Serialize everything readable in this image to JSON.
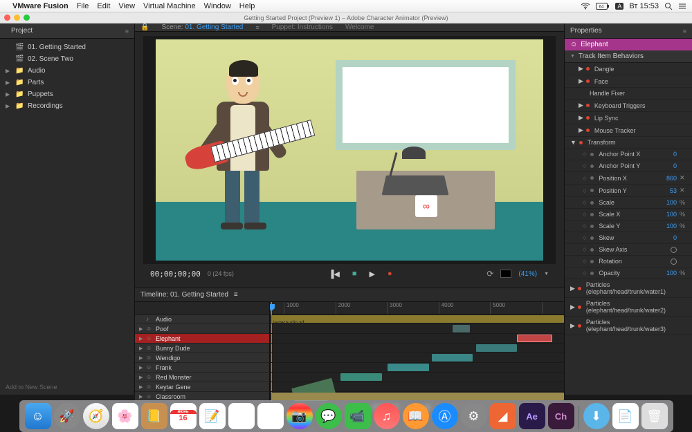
{
  "menubar": {
    "app": "VMware Fusion",
    "items": [
      "File",
      "Edit",
      "View",
      "Virtual Machine",
      "Window",
      "Help"
    ],
    "clock": "Вт 15:53",
    "input_badge": "A"
  },
  "window_title": "Getting Started Project (Preview 1) – Adobe Character Animator (Preview)",
  "project": {
    "title": "Project",
    "items": [
      {
        "icon": "scene",
        "label": "01. Getting Started",
        "expand": false
      },
      {
        "icon": "scene",
        "label": "02. Scene Two",
        "expand": false
      },
      {
        "icon": "folder",
        "label": "Audio",
        "expand": true
      },
      {
        "icon": "folder",
        "label": "Parts",
        "expand": true
      },
      {
        "icon": "folder",
        "label": "Puppets",
        "expand": true
      },
      {
        "icon": "folder",
        "label": "Recordings",
        "expand": true
      }
    ],
    "footer": "Add to New Scene"
  },
  "center": {
    "scene_label": "Scene:",
    "scene_name": "01. Getting Started",
    "puppet_label": "Puppet:",
    "puppet_name": "Instructions",
    "welcome": "Welcome"
  },
  "playback": {
    "timecode": "00;00;00;00",
    "fps": "0 (24 fps)",
    "zoom": "(41%)"
  },
  "timeline": {
    "title": "Timeline: 01. Getting Started",
    "ruler": [
      "1000",
      "2000",
      "3000",
      "4000",
      "5000"
    ],
    "audio_clip": "lasterAudio.aif",
    "tracks": [
      {
        "name": "Audio",
        "icon": "aud",
        "sel": false
      },
      {
        "name": "Poof",
        "icon": "pup",
        "sel": false
      },
      {
        "name": "Elephant",
        "icon": "pup",
        "sel": true
      },
      {
        "name": "Bunny Dude",
        "icon": "pup",
        "sel": false
      },
      {
        "name": "Wendigo",
        "icon": "pup",
        "sel": false
      },
      {
        "name": "Frank",
        "icon": "pup",
        "sel": false
      },
      {
        "name": "Red Monster",
        "icon": "pup",
        "sel": false
      },
      {
        "name": "Keytar Gene",
        "icon": "pup",
        "sel": false
      },
      {
        "name": "Classroom",
        "icon": "pup",
        "sel": false
      }
    ]
  },
  "properties": {
    "title": "Properties",
    "selected": "Elephant",
    "behaviors_title": "Track Item Behaviors",
    "behaviors": [
      "Dangle",
      "Face",
      "Handle Fixer",
      "Keyboard Triggers",
      "Lip Sync",
      "Mouse Tracker"
    ],
    "transform": {
      "title": "Transform",
      "rows": [
        {
          "name": "Anchor Point X",
          "val": "0",
          "unit": ""
        },
        {
          "name": "Anchor Point Y",
          "val": "0",
          "unit": ""
        },
        {
          "name": "Position X",
          "val": "860",
          "unit": "",
          "x": true
        },
        {
          "name": "Position Y",
          "val": "53",
          "unit": "",
          "x": true
        },
        {
          "name": "Scale",
          "val": "100",
          "unit": "%"
        },
        {
          "name": "Scale X",
          "val": "100",
          "unit": "%"
        },
        {
          "name": "Scale Y",
          "val": "100",
          "unit": "%"
        },
        {
          "name": "Skew",
          "val": "0",
          "unit": ""
        },
        {
          "name": "Skew Axis",
          "val": "",
          "unit": "",
          "clock": true
        },
        {
          "name": "Rotation",
          "val": "",
          "unit": "",
          "clock": true
        },
        {
          "name": "Opacity",
          "val": "100",
          "unit": "%"
        }
      ]
    },
    "particles": [
      "Particles (elephant/head/trunk/water1)",
      "Particles (elephant/head/trunk/water2)",
      "Particles (elephant/head/trunk/water3)"
    ]
  },
  "calendar": {
    "month": "июнь",
    "day": "16"
  }
}
